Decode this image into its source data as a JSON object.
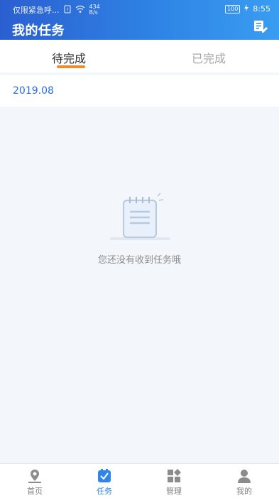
{
  "status_bar": {
    "carrier": "仅限紧急呼...",
    "net_speed": "434 B/s",
    "battery": "100",
    "time": "8:55"
  },
  "header": {
    "title": "我的任务"
  },
  "tabs": [
    {
      "label": "待完成",
      "active": true
    },
    {
      "label": "已完成",
      "active": false
    }
  ],
  "filter": {
    "date": "2019.08"
  },
  "empty_state": {
    "message": "您还没有收到任务哦"
  },
  "bottom_nav": [
    {
      "label": "首页",
      "icon": "map-pin-icon",
      "active": false
    },
    {
      "label": "任务",
      "icon": "task-check-icon",
      "active": true
    },
    {
      "label": "管理",
      "icon": "grid-manage-icon",
      "active": false
    },
    {
      "label": "我的",
      "icon": "user-icon",
      "active": false
    }
  ],
  "colors": {
    "header_start": "#2b5fd0",
    "header_end": "#3a9df0",
    "accent": "#2f86e6",
    "tab_indicator": "#f28b2a"
  }
}
